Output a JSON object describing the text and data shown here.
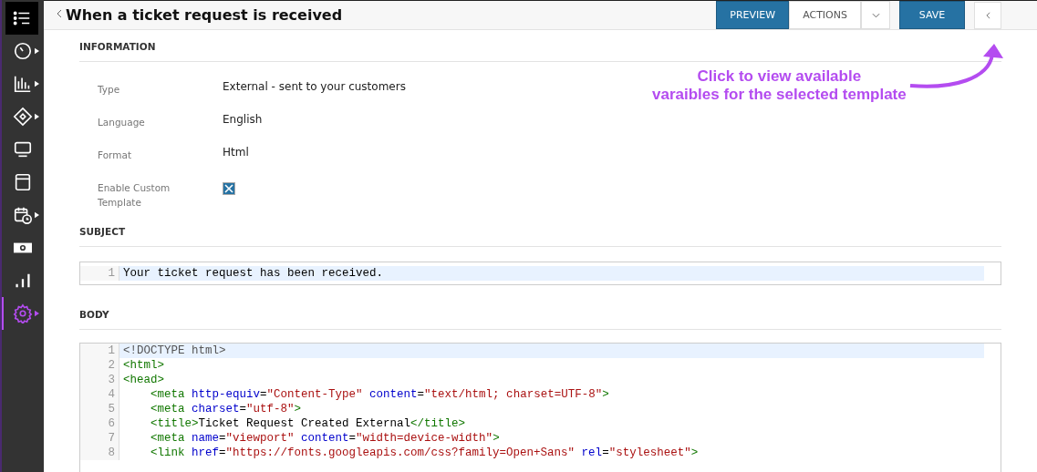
{
  "sidebar": {
    "items": [
      {
        "kind": "list",
        "selected": false,
        "highlighted": true,
        "submenu": false
      },
      {
        "kind": "gauge",
        "selected": false,
        "highlighted": false,
        "submenu": true
      },
      {
        "kind": "bar-chart",
        "selected": false,
        "highlighted": false,
        "submenu": true
      },
      {
        "kind": "ticket",
        "selected": false,
        "highlighted": false,
        "submenu": true
      },
      {
        "kind": "monitor",
        "selected": false,
        "highlighted": false,
        "submenu": false
      },
      {
        "kind": "window",
        "selected": false,
        "highlighted": false,
        "submenu": false
      },
      {
        "kind": "calendar-clock",
        "selected": false,
        "highlighted": false,
        "submenu": true
      },
      {
        "kind": "money",
        "selected": false,
        "highlighted": false,
        "submenu": false
      },
      {
        "kind": "signal",
        "selected": false,
        "highlighted": false,
        "submenu": false
      },
      {
        "kind": "gear",
        "selected": true,
        "highlighted": false,
        "submenu": true
      }
    ]
  },
  "header": {
    "title": "When a ticket request is received",
    "buttons": {
      "preview": "PREVIEW",
      "actions": "ACTIONS",
      "save": "SAVE"
    }
  },
  "information": {
    "heading": "INFORMATION",
    "fields": [
      {
        "label": "Type",
        "kind": "text",
        "value": "External - sent to your customers"
      },
      {
        "label": "Language",
        "kind": "text",
        "value": "English"
      },
      {
        "label": "Format",
        "kind": "text",
        "value": "Html"
      },
      {
        "label": "Enable Custom Template",
        "kind": "checkbox",
        "checked": true
      }
    ]
  },
  "subject": {
    "heading": "SUBJECT",
    "lines": [
      {
        "number": "1",
        "text": "Your ticket request has been received."
      }
    ]
  },
  "body": {
    "heading": "BODY",
    "lines": [
      {
        "number": "1",
        "indented": false,
        "tokens": [
          {
            "kind": "doctype",
            "text": "<!DOCTYPE html>"
          }
        ]
      },
      {
        "number": "2",
        "indented": false,
        "tokens": [
          {
            "kind": "tag",
            "text": "<html>"
          }
        ]
      },
      {
        "number": "3",
        "indented": false,
        "tokens": [
          {
            "kind": "tag",
            "text": "<head>"
          }
        ]
      },
      {
        "number": "4",
        "indented": true,
        "tokens": [
          {
            "kind": "tag",
            "text": "<meta"
          },
          {
            "kind": "attr",
            "text": "http-equiv",
            "spaced": true
          },
          {
            "kind": "text",
            "text": "="
          },
          {
            "kind": "string",
            "text": "\"Content-Type\""
          },
          {
            "kind": "attr",
            "text": "content",
            "spaced": true
          },
          {
            "kind": "text",
            "text": "="
          },
          {
            "kind": "string",
            "text": "\"text/html; charset=UTF-8\""
          },
          {
            "kind": "tag",
            "text": ">"
          }
        ]
      },
      {
        "number": "5",
        "indented": true,
        "tokens": [
          {
            "kind": "tag",
            "text": "<meta"
          },
          {
            "kind": "attr",
            "text": "charset",
            "spaced": true
          },
          {
            "kind": "text",
            "text": "="
          },
          {
            "kind": "string",
            "text": "\"utf-8\""
          },
          {
            "kind": "tag",
            "text": ">"
          }
        ]
      },
      {
        "number": "6",
        "indented": true,
        "tokens": [
          {
            "kind": "tag",
            "text": "<title>"
          },
          {
            "kind": "text",
            "text": "Ticket Request Created External"
          },
          {
            "kind": "tag",
            "text": "</title>"
          }
        ]
      },
      {
        "number": "7",
        "indented": true,
        "tokens": [
          {
            "kind": "tag",
            "text": "<meta"
          },
          {
            "kind": "attr",
            "text": "name",
            "spaced": true
          },
          {
            "kind": "text",
            "text": "="
          },
          {
            "kind": "string",
            "text": "\"viewport\""
          },
          {
            "kind": "attr",
            "text": "content",
            "spaced": true
          },
          {
            "kind": "text",
            "text": "="
          },
          {
            "kind": "string",
            "text": "\"width=device-width\""
          },
          {
            "kind": "tag",
            "text": ">"
          }
        ]
      },
      {
        "number": "8",
        "indented": true,
        "tokens": [
          {
            "kind": "tag",
            "text": "<link"
          },
          {
            "kind": "attr",
            "text": "href",
            "spaced": true
          },
          {
            "kind": "text",
            "text": "="
          },
          {
            "kind": "string",
            "text": "\"https://fonts.googleapis.com/css?family=Open+Sans\""
          },
          {
            "kind": "attr",
            "text": "rel",
            "spaced": true
          },
          {
            "kind": "text",
            "text": "="
          },
          {
            "kind": "string",
            "text": "\"stylesheet\""
          },
          {
            "kind": "tag",
            "text": ">"
          }
        ]
      }
    ]
  },
  "annotation": {
    "lines": [
      "Click to view available",
      "varaibles for the selected template"
    ]
  }
}
